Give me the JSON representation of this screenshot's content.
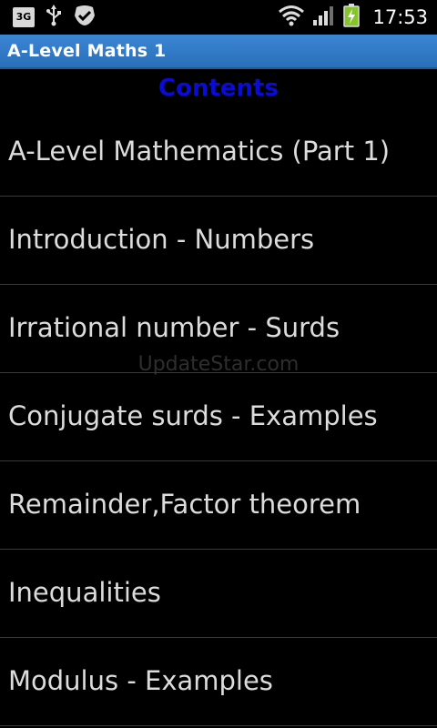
{
  "status_bar": {
    "network_badge": "3G",
    "icons": [
      "usb-icon",
      "check-shield-icon",
      "wifi-icon",
      "signal-icon",
      "battery-charging-icon"
    ],
    "time": "17:53"
  },
  "title_bar": {
    "title": "A-Level Maths 1",
    "background_color": "#3282d0"
  },
  "contents": {
    "heading": "Contents",
    "heading_color": "#0b0bd8"
  },
  "list": {
    "items": [
      {
        "label": "A-Level Mathematics (Part 1)"
      },
      {
        "label": "Introduction - Numbers"
      },
      {
        "label": "Irrational number - Surds"
      },
      {
        "label": "Conjugate surds - Examples"
      },
      {
        "label": "Remainder,Factor theorem"
      },
      {
        "label": "Inequalities"
      },
      {
        "label": "Modulus - Examples"
      }
    ]
  },
  "watermark": "UpdateStar.com"
}
